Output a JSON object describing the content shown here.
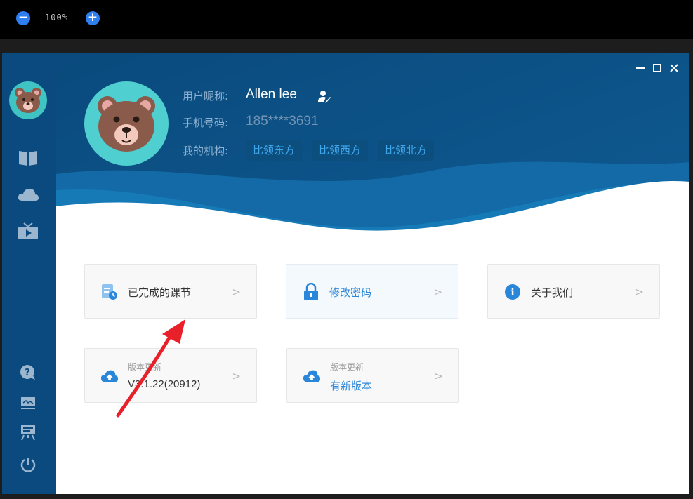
{
  "zoom": {
    "level": "100%"
  },
  "profile": {
    "nickname_label": "用户昵称:",
    "nickname": "Allen lee",
    "phone_label": "手机号码:",
    "phone": "185****3691",
    "org_label": "我的机构:",
    "orgs": [
      "比领东方",
      "比领西方",
      "比领北方"
    ]
  },
  "cards": {
    "completed_lessons": "已完成的课节",
    "change_password": "修改密码",
    "about_us": "关于我们",
    "version_left": {
      "subtitle": "版本更新",
      "value": "V3.1.22(20912)"
    },
    "version_right": {
      "subtitle": "版本更新",
      "value": "有新版本"
    },
    "chevron": ">"
  },
  "colors": {
    "sidebar": "#0b4a7e",
    "header": "#0d5588",
    "accent": "#2a86d8",
    "annotation_arrow": "#e8202a"
  }
}
